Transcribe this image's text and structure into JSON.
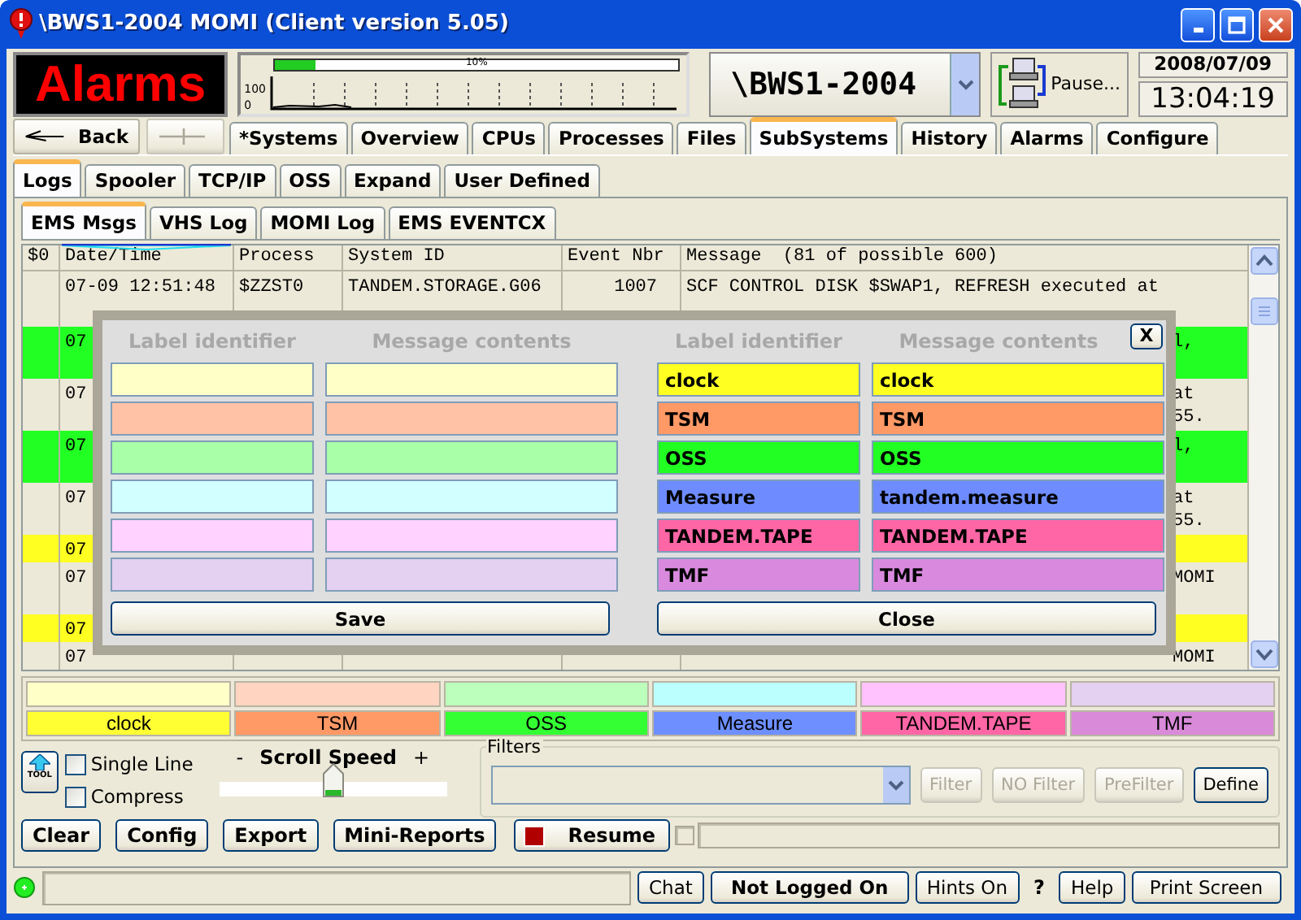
{
  "window": {
    "title": "\\BWS1-2004 MOMI (Client version 5.05)"
  },
  "header": {
    "alarm_label": "Alarms",
    "cpu_meter": {
      "level": 0.1,
      "reading": "10%"
    },
    "graph_axis": [
      "100",
      "0"
    ],
    "system": "\\BWS1-2004",
    "pause_button": "Pause...",
    "date": "2008/07/09",
    "time": "13:04:19"
  },
  "nav": {
    "back": "Back",
    "forward": {
      "disabled": true
    },
    "tabs": [
      {
        "label": "*Systems",
        "selected": false
      },
      {
        "label": "Overview",
        "selected": false
      },
      {
        "label": "CPUs",
        "selected": false
      },
      {
        "label": "Processes",
        "selected": false
      },
      {
        "label": "Files",
        "selected": false
      },
      {
        "label": "SubSystems",
        "selected": true
      },
      {
        "label": "History",
        "selected": false
      },
      {
        "label": "Alarms",
        "selected": false
      },
      {
        "label": "Configure",
        "selected": false
      }
    ]
  },
  "subtabs": [
    {
      "label": "Logs",
      "selected": true
    },
    {
      "label": "Spooler",
      "selected": false
    },
    {
      "label": "TCP/IP",
      "selected": false
    },
    {
      "label": "OSS",
      "selected": false
    },
    {
      "label": "Expand",
      "selected": false
    },
    {
      "label": "User Defined",
      "selected": false
    }
  ],
  "log_tabs": [
    {
      "label": "EMS Msgs",
      "selected": true
    },
    {
      "label": "VHS Log",
      "selected": false
    },
    {
      "label": "MOMI Log",
      "selected": false
    },
    {
      "label": "EMS EVENTCX",
      "selected": false
    }
  ],
  "table": {
    "columns": [
      "$0",
      "Date/Time",
      "Process",
      "System ID",
      "Event Nbr",
      "Message  (81 of possible 600)"
    ],
    "rows": [
      {
        "kind": "tall",
        "color": "#ece9d8",
        "date": "07-09 12:51:48",
        "process": "$ZZST0",
        "system_id": "TANDEM.STORAGE.G06",
        "event_nbr": "1007",
        "message": [
          "SCF CONTROL DISK $SWAP1, REFRESH executed at"
        ]
      },
      {
        "kind": "double",
        "color": "#22ff22",
        "date": "07",
        "message_tail": [
          "l,"
        ]
      },
      {
        "kind": "double",
        "color": "#ece9d8",
        "date": "07",
        "message_tail": [
          "at",
          "55."
        ]
      },
      {
        "kind": "double",
        "color": "#22ff22",
        "date": "07",
        "message_tail": [
          "l,"
        ]
      },
      {
        "kind": "double",
        "color": "#ece9d8",
        "date": "07",
        "message_tail": [
          "at",
          "55."
        ]
      },
      {
        "kind": "single",
        "color": "#ffff22",
        "date": "07"
      },
      {
        "kind": "double",
        "color": "#ece9d8",
        "date": "07",
        "message_tail": [
          "MOMI"
        ]
      },
      {
        "kind": "single",
        "color": "#ffff22",
        "date": "07"
      },
      {
        "kind": "single",
        "color": "#ece9d8",
        "date": "07",
        "message_tail": [
          "MOMI"
        ]
      }
    ]
  },
  "dialog": {
    "headings": [
      "Label identifier",
      "Message contents",
      "Label identifier",
      "Message contents"
    ],
    "blank_rows": [
      {
        "color": "#ffffc8"
      },
      {
        "color": "#ffc2a6"
      },
      {
        "color": "#a8ffa8"
      },
      {
        "color": "#d2ffff"
      },
      {
        "color": "#ffd2ff"
      },
      {
        "color": "#e4d0f0"
      }
    ],
    "rows": [
      {
        "label": "clock",
        "contents": "clock",
        "color": "#ffff22"
      },
      {
        "label": "TSM",
        "contents": "TSM",
        "color": "#ff9966"
      },
      {
        "label": "OSS",
        "contents": "OSS",
        "color": "#22ff22"
      },
      {
        "label": "Measure",
        "contents": "tandem.measure",
        "color": "#6e8cff"
      },
      {
        "label": "TANDEM.TAPE",
        "contents": "TANDEM.TAPE",
        "color": "#ff66a6"
      },
      {
        "label": "TMF",
        "contents": "TMF",
        "color": "#d98ade"
      }
    ],
    "close": "X",
    "save": "Save",
    "close_button": "Close"
  },
  "legend": {
    "blank": [
      {
        "color": "#ffffc8"
      },
      {
        "color": "#ffd4c0"
      },
      {
        "color": "#bcffbc"
      },
      {
        "color": "#bcffff"
      },
      {
        "color": "#ffc2ff"
      },
      {
        "color": "#e4d0f0"
      }
    ],
    "labels": [
      {
        "label": "clock",
        "color": "#ffff33"
      },
      {
        "label": "TSM",
        "color": "#ff9966"
      },
      {
        "label": "OSS",
        "color": "#33ff33"
      },
      {
        "label": "Measure",
        "color": "#6e8fff"
      },
      {
        "label": "TANDEM.TAPE",
        "color": "#ff66a6"
      },
      {
        "label": "TMF",
        "color": "#d98ad9"
      }
    ]
  },
  "controls": {
    "tool_label": "TOOL",
    "checkboxes": [
      {
        "label": "Single Line",
        "checked": false
      },
      {
        "label": "Compress",
        "checked": false
      }
    ],
    "scroll_speed": {
      "minus": "-",
      "label": "Scroll Speed",
      "plus": "+",
      "level": 0.5
    },
    "filters": {
      "label": "Filters",
      "buttons": [
        {
          "label": "Filter",
          "disabled": true
        },
        {
          "label": "NO Filter",
          "disabled": true
        },
        {
          "label": "PreFilter",
          "disabled": true
        },
        {
          "label": "Define",
          "disabled": false
        }
      ]
    }
  },
  "actions": [
    "Clear",
    "Config",
    "Export",
    "Mini-Reports"
  ],
  "resume": "Resume",
  "status_bar": {
    "chat": "Chat",
    "login": "Not Logged On",
    "hints": "Hints On",
    "question": "?",
    "help": "Help",
    "print": "Print Screen"
  }
}
